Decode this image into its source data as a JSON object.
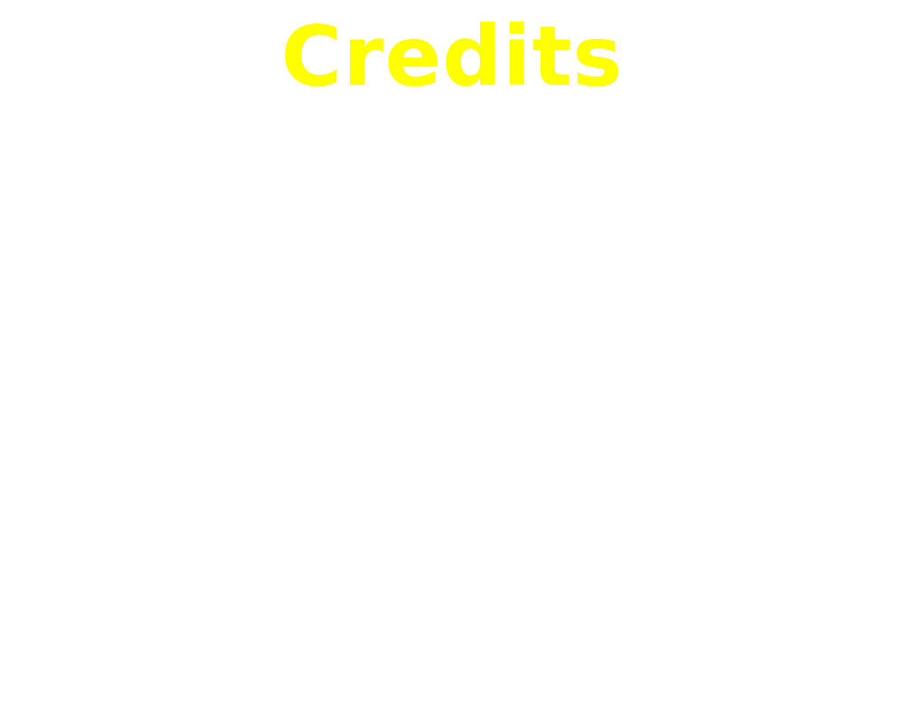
{
  "screen": {
    "title": "Credits",
    "title_color": "#ffff00",
    "background_color": "#ffffff"
  }
}
